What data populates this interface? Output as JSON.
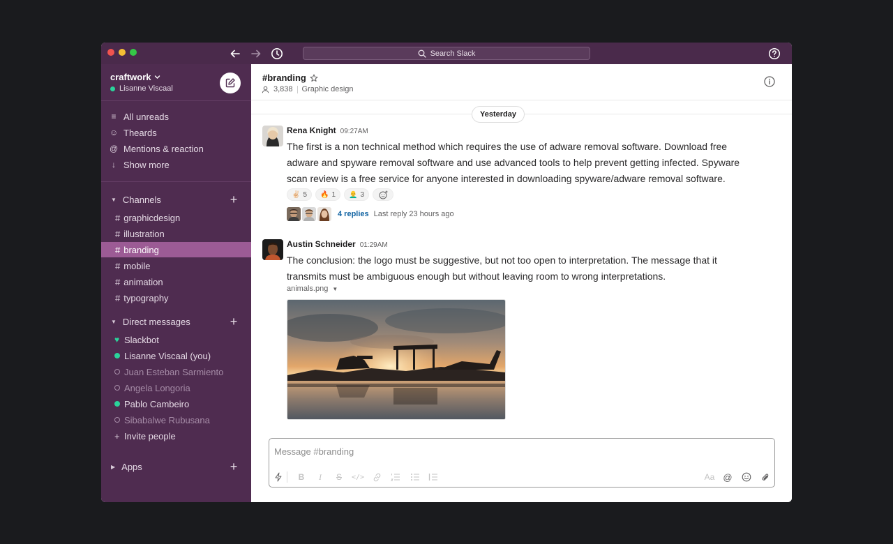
{
  "titlebar": {
    "search_placeholder": "Search Slack"
  },
  "workspace": {
    "name": "craftwork",
    "user": "Lisanne Viscaal"
  },
  "nav": [
    {
      "label": "All unreads",
      "icon": "list-icon"
    },
    {
      "label": "Theards",
      "icon": "threads-icon"
    },
    {
      "label": "Mentions & reaction",
      "icon": "at-icon"
    },
    {
      "label": "Show more",
      "icon": "arrow-down-icon"
    }
  ],
  "channels_section": {
    "title": "Channels",
    "items": [
      "graphicdesign",
      "illustration",
      "branding",
      "mobile",
      "animation",
      "typography"
    ],
    "active": "branding"
  },
  "dm_section": {
    "title": "Direct messages",
    "items": [
      {
        "name": "Slackbot",
        "status": "bot"
      },
      {
        "name": "Lisanne Viscaal  (you)",
        "status": "online"
      },
      {
        "name": "Juan Esteban Sarmiento",
        "status": "away"
      },
      {
        "name": "Angela Longoria",
        "status": "away"
      },
      {
        "name": "Pablo Cambeiro",
        "status": "online"
      },
      {
        "name": "Sibabalwe Rubusana",
        "status": "away"
      }
    ],
    "invite": "Invite people"
  },
  "apps_section": {
    "title": "Apps"
  },
  "channel": {
    "name": "#branding",
    "members": "3,838",
    "topic": "Graphic design"
  },
  "date_divider": "Yesterday",
  "messages": [
    {
      "author": "Rena Knight",
      "time": "09:27AM",
      "text": "The first is a non technical method which requires the use of adware removal software. Download free adware and spyware removal software and use advanced tools to help prevent getting infected. Spyware scan review is a free service for anyone interested in downloading spyware/adware removal software.",
      "reactions": [
        {
          "emoji": "✌🏻",
          "count": "5"
        },
        {
          "emoji": "🔥",
          "count": "1"
        },
        {
          "emoji": "👨‍🦲",
          "count": "3"
        }
      ],
      "thread": {
        "replies": "4 replies",
        "last_reply": "Last reply 23 hours ago"
      }
    },
    {
      "author": "Austin Schneider",
      "time": "01:29AM",
      "text": "The conclusion: the logo must be suggestive, but not too open to interpretation. The message that it transmits must be ambiguous enough but without leaving room to wrong interpretations.",
      "file_name": "animals.png"
    }
  ],
  "composer": {
    "placeholder": "Message #branding",
    "format_text_label": "Aa"
  },
  "colors": {
    "sidebar": "#4f2c50",
    "titlebar": "#4a2a4b",
    "active_channel": "#9c5b95",
    "online": "#2bd39b",
    "link": "#1264a3"
  }
}
